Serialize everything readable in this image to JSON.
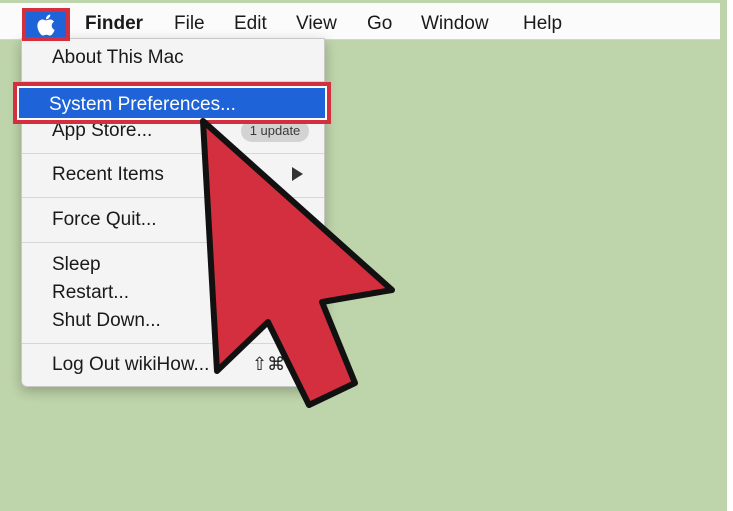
{
  "menubar": {
    "apple_icon": "apple-icon",
    "items": [
      "Finder",
      "File",
      "Edit",
      "View",
      "Go",
      "Window",
      "Help"
    ]
  },
  "apple_menu": {
    "about": "About This Mac",
    "system_preferences": "System Preferences...",
    "app_store": "App Store...",
    "app_store_badge": "1 update",
    "recent_items": "Recent Items",
    "force_quit": "Force Quit...",
    "sleep": "Sleep",
    "restart": "Restart...",
    "shut_down": "Shut Down...",
    "log_out": "Log Out wikiHow...",
    "log_out_shortcut": "⇧⌘Q"
  },
  "colors": {
    "background": "#bed4aa",
    "menu_highlight": "#1f63d8",
    "annotation_red": "#d32f3e"
  },
  "annotation": {
    "pointer_icon": "red-pointer-arrow-icon"
  }
}
